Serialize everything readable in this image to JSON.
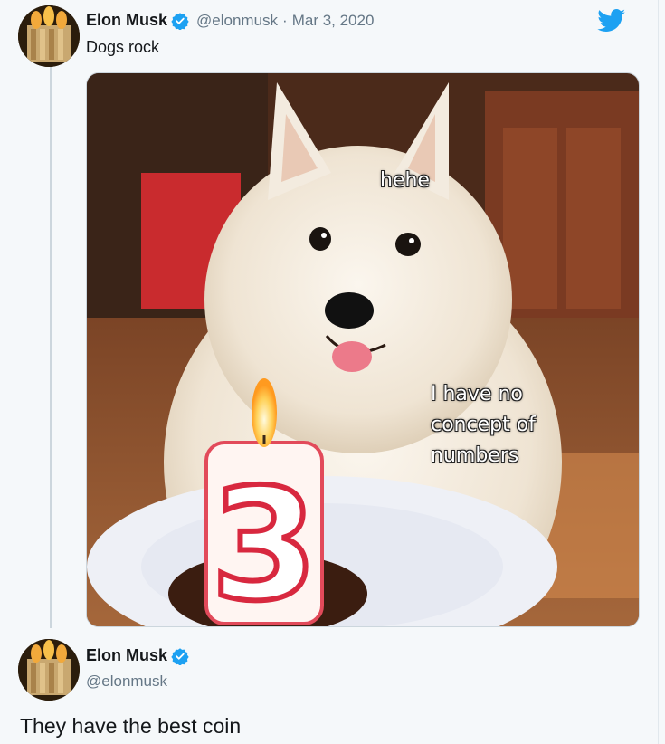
{
  "tweet": {
    "display_name": "Elon Musk",
    "handle": "@elonmusk",
    "separator": "·",
    "date": "Mar 3, 2020",
    "text": "Dogs rock",
    "media": {
      "description_icon": "samoyed-birthday-photo",
      "caption_top": "hehe",
      "caption_lines": [
        "I have no",
        "concept of",
        "numbers"
      ],
      "candle_number": "3"
    }
  },
  "reply": {
    "display_name": "Elon Musk",
    "handle": "@elonmusk",
    "text": "They have the best coin"
  },
  "colors": {
    "twitter_blue": "#1da1f2",
    "background": "#f5f8fa",
    "secondary_text": "#657786",
    "primary_text": "#14171a"
  },
  "icons": [
    "twitter-bird-icon",
    "verified-badge-icon"
  ]
}
